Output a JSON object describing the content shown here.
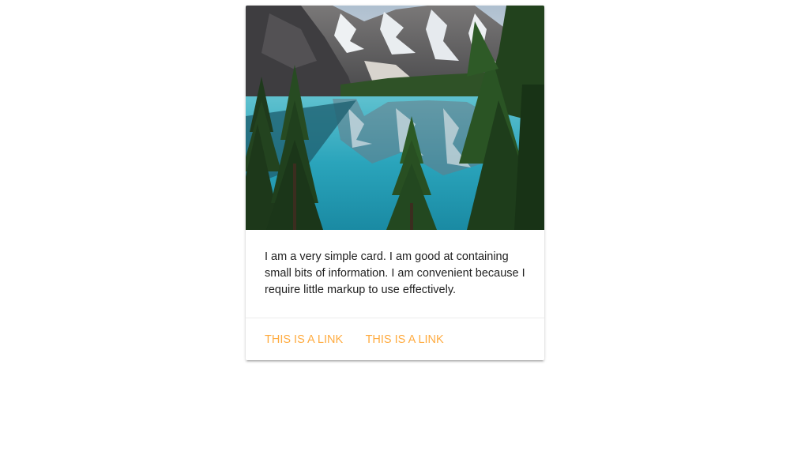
{
  "card": {
    "image": {
      "icon": "mountain-lake-photo",
      "colors": {
        "sky": "#b9c7d6",
        "mountain": "#5b5a5e",
        "snow": "#e8ecef",
        "lake": "#2fa6bd",
        "lake_deep": "#1b7f96",
        "forest": "#1f3a1c",
        "tree": "#2c5a26"
      }
    },
    "content": {
      "text": "I am a very simple card. I am good at containing small bits of information. I am convenient because I require little markup to use effectively."
    },
    "actions": [
      {
        "label": "This is a link"
      },
      {
        "label": "This is a link"
      }
    ],
    "accent_color": "#ffab40"
  }
}
